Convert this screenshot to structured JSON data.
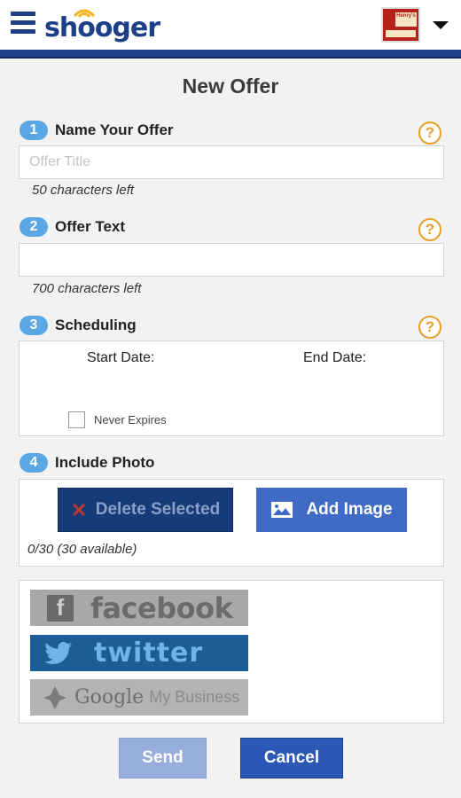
{
  "header": {
    "logo_text": "shooger",
    "store_thumb_text": "Henry's"
  },
  "page_title": "New Offer",
  "steps": [
    {
      "num": "1",
      "label": "Name Your Offer"
    },
    {
      "num": "2",
      "label": "Offer Text"
    },
    {
      "num": "3",
      "label": "Scheduling"
    },
    {
      "num": "4",
      "label": "Include Photo"
    }
  ],
  "help_glyph": "?",
  "offer_title": {
    "placeholder": "Offer Title",
    "value": "",
    "hint": "50 characters left"
  },
  "offer_text": {
    "placeholder": "",
    "value": "",
    "hint": "700 characters left"
  },
  "scheduling": {
    "start_label": "Start Date:",
    "end_label": "End Date:",
    "never_expires_label": "Never Expires",
    "never_expires_checked": false
  },
  "photo": {
    "delete_label": "Delete Selected",
    "add_label": "Add Image",
    "count_text": "0/30 (30 available)"
  },
  "social": {
    "facebook": "facebook",
    "twitter": "twitter",
    "google_brand": "Google",
    "google_suffix": "My Business"
  },
  "actions": {
    "send_label": "Send",
    "cancel_label": "Cancel"
  },
  "colors": {
    "brand_navy": "#1c3f85",
    "step_badge": "#5aa7e3",
    "help_orange": "#e6a028",
    "twitter_blue": "#1c5d97",
    "add_button": "#3f6bc7",
    "cancel_button": "#2b58b5",
    "send_button_disabled": "#97aedc"
  },
  "icons": {
    "menu": "hamburger-menu-icon",
    "caret": "chevron-down-icon",
    "help": "question-circle-icon",
    "delete": "x-icon",
    "image": "image-icon"
  }
}
